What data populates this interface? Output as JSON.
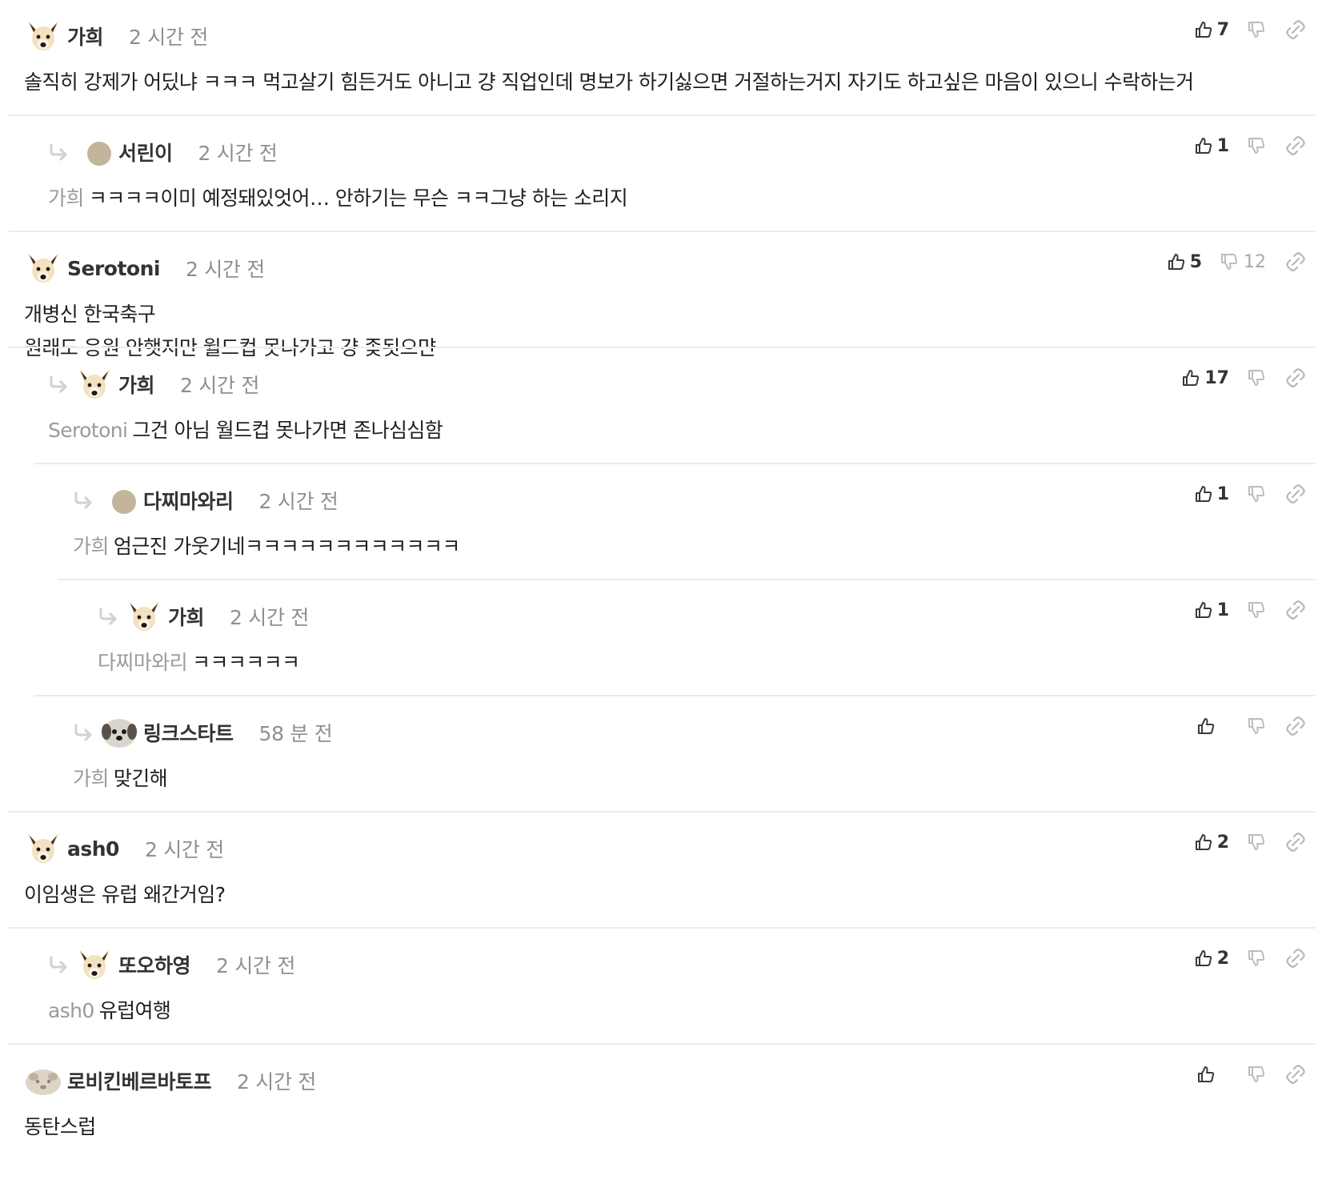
{
  "comments": [
    {
      "depth": 0,
      "avatar": "chihuahua-avatar",
      "author": "가희",
      "time": "2 시간 전",
      "mention": "",
      "lines": [
        "솔직히 강제가 어딨냐 ㅋㅋㅋ 먹고살기 힘든거도 아니고 걍 직업인데 명보가 하기싫으면 거절하는거지 자기도 하고싶은 마음이 있으니 수락하는거"
      ],
      "likes": "7",
      "dislikes": ""
    },
    {
      "depth": 1,
      "avatar": "default-circle-avatar",
      "author": "서린이",
      "time": "2 시간 전",
      "mention": "가희",
      "lines": [
        "ㅋㅋㅋㅋ이미 예정돼있엇어… 안하기는 무슨 ㅋㅋ그냥 하는 소리지"
      ],
      "likes": "1",
      "dislikes": ""
    },
    {
      "depth": 0,
      "avatar": "chihuahua-avatar",
      "author": "Serotoni",
      "time": "2 시간 전",
      "mention": "",
      "lines": [
        "개병신 한국축구",
        "원래도 응원 안햇지만 월드컵 못나가고 걍 좆됫으먄"
      ],
      "likes": "5",
      "dislikes": "12"
    },
    {
      "depth": 1,
      "avatar": "chihuahua-avatar",
      "author": "가희",
      "time": "2 시간 전",
      "mention": "Serotoni",
      "lines": [
        "그건 아님 월드컵 못나가면 존나심심함"
      ],
      "likes": "17",
      "dislikes": ""
    },
    {
      "depth": 2,
      "avatar": "default-circle-avatar",
      "author": "다찌마와리",
      "time": "2 시간 전",
      "mention": "가희",
      "lines": [
        "엄근진 가웃기네ㅋㅋㅋㅋㅋㅋㅋㅋㅋㅋㅋㅋ"
      ],
      "likes": "1",
      "dislikes": ""
    },
    {
      "depth": 3,
      "avatar": "chihuahua-avatar",
      "author": "가희",
      "time": "2 시간 전",
      "mention": "다찌마와리",
      "lines": [
        "ㅋㅋㅋㅋㅋㅋ"
      ],
      "likes": "1",
      "dislikes": ""
    },
    {
      "depth": 2,
      "avatar": "puppy-avatar",
      "author": "링크스타트",
      "time": "58 분 전",
      "mention": "가희",
      "lines": [
        "맞긴해"
      ],
      "likes": "",
      "dislikes": ""
    },
    {
      "depth": 0,
      "avatar": "chihuahua-avatar",
      "author": "ash0",
      "time": "2 시간 전",
      "mention": "",
      "lines": [
        "이임생은 유럽 왜간거임?"
      ],
      "likes": "2",
      "dislikes": ""
    },
    {
      "depth": 1,
      "avatar": "chihuahua-avatar",
      "author": "또오하영",
      "time": "2 시간 전",
      "mention": "ash0",
      "lines": [
        "유럽여행"
      ],
      "likes": "2",
      "dislikes": ""
    },
    {
      "depth": 0,
      "avatar": "blurred-animal-avatar",
      "author": "로비킨베르바토프",
      "time": "2 시간 전",
      "mention": "",
      "lines": [
        "동탄스럽"
      ],
      "likes": "",
      "dislikes": ""
    }
  ],
  "icons": {
    "reply": "reply-arrow-icon",
    "like": "thumbs-up-icon",
    "dislike": "thumbs-down-icon",
    "link": "link-icon"
  },
  "colors": {
    "text": "#1f1f1f",
    "author": "#333333",
    "muted": "#8f8f8f",
    "mention": "#9a9a9a",
    "divider": "#ececec",
    "reply_arrow": "#d3d3d3",
    "default_avatar": "#c2b59b"
  }
}
